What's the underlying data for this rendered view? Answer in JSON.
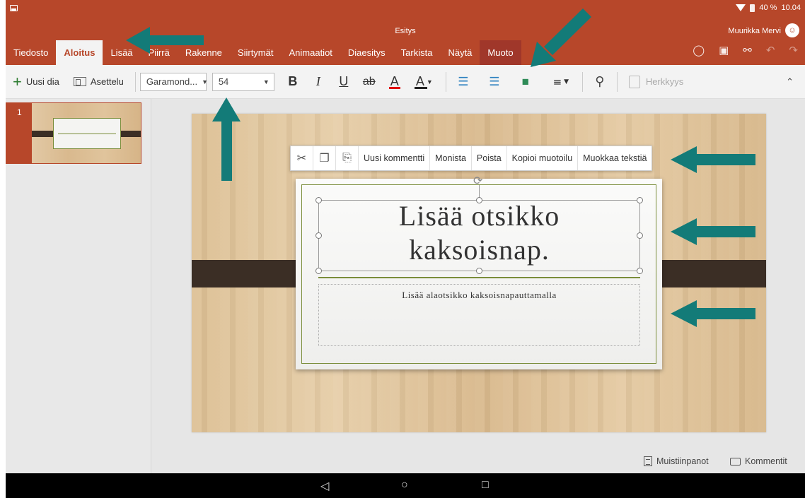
{
  "status_bar": {
    "battery": "40 %",
    "time": "10.04"
  },
  "document": {
    "title": "Esitys"
  },
  "user": {
    "name": "Muurikka Mervi",
    "avatar_icon": "person-icon"
  },
  "tabs": [
    {
      "label": "Tiedosto"
    },
    {
      "label": "Aloitus"
    },
    {
      "label": "Lisää"
    },
    {
      "label": "Piirrä"
    },
    {
      "label": "Rakenne"
    },
    {
      "label": "Siirtymät"
    },
    {
      "label": "Animaatiot"
    },
    {
      "label": "Diaesitys"
    },
    {
      "label": "Tarkista"
    },
    {
      "label": "Näytä"
    },
    {
      "label": "Muoto"
    }
  ],
  "active_tab": "Aloitus",
  "toolbar": {
    "new_slide": "Uusi dia",
    "layout": "Asettelu",
    "font_name": "Garamond...",
    "font_size": "54",
    "bold": "B",
    "italic": "I",
    "underline": "U",
    "strikethrough": "ab",
    "font_color": "A",
    "highlight": "A",
    "sensitivity": "Herkkyys"
  },
  "slide_panel": {
    "slide_number": "1"
  },
  "context_menu": {
    "new_comment": "Uusi kommentti",
    "duplicate": "Monista",
    "delete": "Poista",
    "copy_format": "Kopioi muotoilu",
    "edit_text": "Muokkaa tekstiä"
  },
  "slide": {
    "title": "Lisää otsikko\nkaksoisnap.",
    "subtitle": "Lisää alaotsikko kaksoisnapauttamalla"
  },
  "footer": {
    "notes": "Muistiinpanot",
    "comments": "Kommentit"
  },
  "colors": {
    "ribbon": "#b7472a",
    "annotation_arrow": "#137b78",
    "accent_green": "#7a8d3a"
  }
}
